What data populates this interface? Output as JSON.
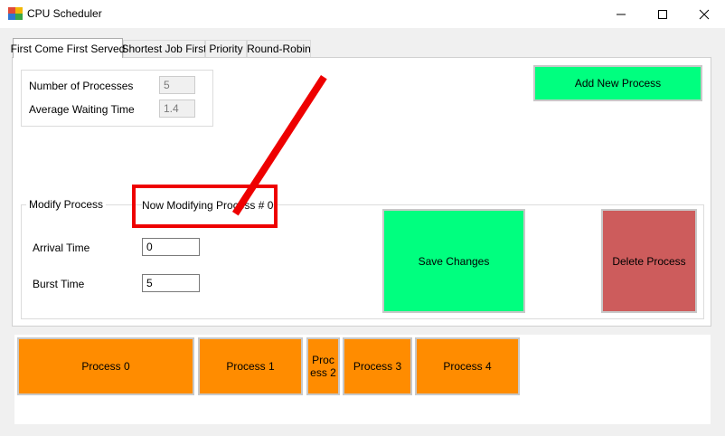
{
  "window": {
    "title": "CPU Scheduler",
    "icons": {
      "app": "cpu-scheduler-app-icon",
      "minimize": "minimize-icon",
      "maximize": "maximize-icon",
      "close": "close-icon"
    }
  },
  "tabs": [
    {
      "label": "First Come First Served",
      "active": true
    },
    {
      "label": "Shortest Job First",
      "active": false
    },
    {
      "label": "Priority",
      "active": false
    },
    {
      "label": "Round-Robin",
      "active": false
    }
  ],
  "summary": {
    "num_processes_label": "Number of Processes",
    "num_processes_value": "5",
    "avg_wait_label": "Average Waiting Time",
    "avg_wait_value": "1.4"
  },
  "add_process_label": "Add New Process",
  "modify": {
    "group_title": "Modify Process",
    "status_text": "Now Modifying Process # 0",
    "arrival_label": "Arrival Time",
    "arrival_value": "0",
    "burst_label": "Burst Time",
    "burst_value": "5",
    "save_label": "Save Changes",
    "delete_label": "Delete Process"
  },
  "gantt": [
    {
      "label": "Process 0"
    },
    {
      "label": "Process 1"
    },
    {
      "label": "Proc\ness 2"
    },
    {
      "label": "Process 3"
    },
    {
      "label": "Process 4"
    }
  ],
  "colors": {
    "accent_green": "#00ff7f",
    "delete_red": "#cd5c5c",
    "process_orange": "#ff8c00",
    "annotation_red": "#ee0000"
  }
}
